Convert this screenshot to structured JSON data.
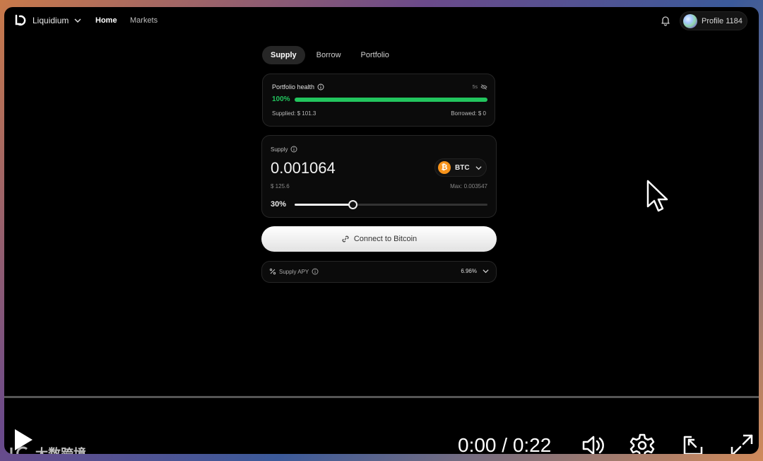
{
  "app": {
    "name": "Liquidium"
  },
  "nav": {
    "home": "Home",
    "markets": "Markets"
  },
  "profile": {
    "label": "Profile 1184"
  },
  "tabs": [
    {
      "label": "Supply",
      "active": true
    },
    {
      "label": "Borrow",
      "active": false
    },
    {
      "label": "Portfolio",
      "active": false
    }
  ],
  "health": {
    "title": "Portfolio health",
    "refresh": "5s",
    "percent_label": "100%",
    "percent_value": 1.0,
    "supplied": "Supplied: $ 101.3",
    "borrowed": "Borrowed: $ 0",
    "color": "#22c55e"
  },
  "supply": {
    "label": "Supply",
    "amount": "0.001064",
    "token": "BTC",
    "token_icon": "bitcoin-icon",
    "usd": "$ 125.6",
    "max": "Max: 0.003547",
    "slider_label": "30%",
    "slider_value": 0.3
  },
  "connect": {
    "label": "Connect to Bitcoin"
  },
  "apy": {
    "label": "Supply APY",
    "value": "6.96%"
  },
  "player": {
    "timecode": "0:00 / 0:22",
    "watermark": "大数跨境"
  }
}
